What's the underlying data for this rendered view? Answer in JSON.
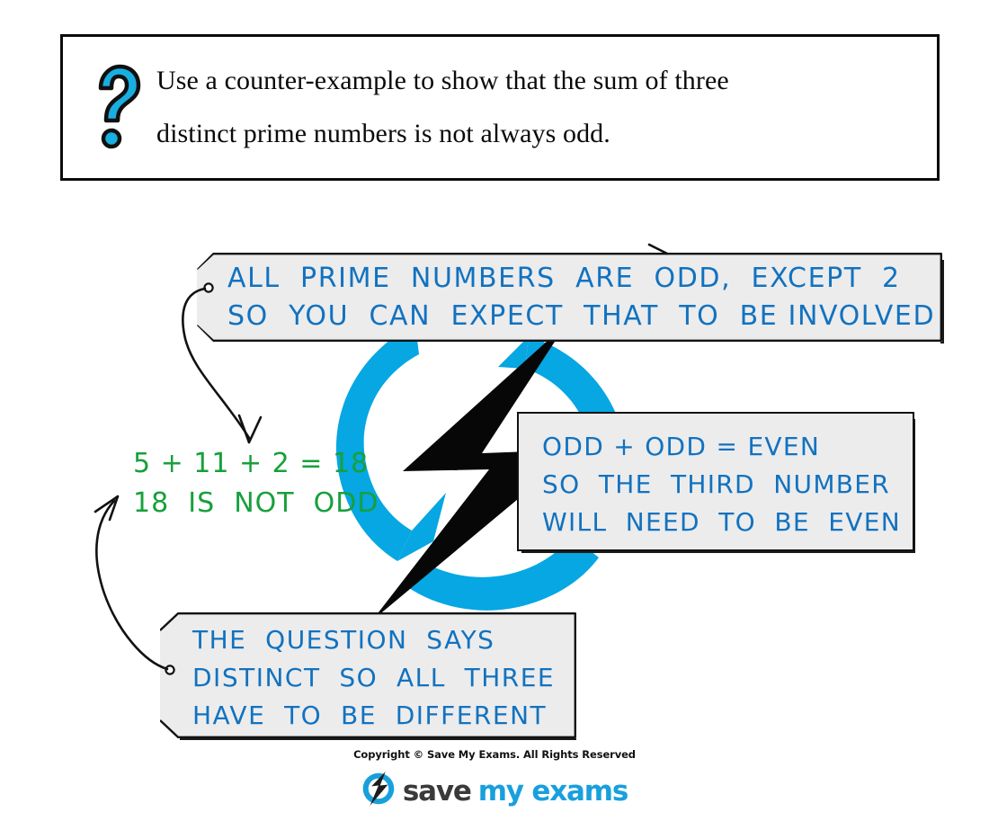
{
  "question": {
    "icon": "question-mark-icon",
    "line1": "Use a counter-example to show that the sum of three",
    "line2": "distinct prime numbers is not always odd."
  },
  "annotations": {
    "prime_note": {
      "line1": "ALL  PRIME  NUMBERS  ARE  ODD,  EXCEPT  2",
      "line2": "SO  YOU  CAN  EXPECT  THAT  TO  BE INVOLVED"
    },
    "odd_note": {
      "line1": "ODD + ODD = EVEN",
      "line2": "SO  THE  THIRD  NUMBER",
      "line3": "WILL  NEED  TO  BE  EVEN"
    },
    "distinct_note": {
      "line1": "THE  QUESTION  SAYS",
      "line2": "DISTINCT  SO  ALL  THREE",
      "line3": "HAVE  TO  BE  DIFFERENT"
    }
  },
  "working": {
    "line1": "5 + 11 + 2 = 18",
    "line2": "18  IS  NOT  ODD"
  },
  "footer": {
    "copyright": "Copyright © Save My Exams. All Rights Reserved",
    "logo_primary": "save",
    "logo_secondary": "my exams"
  },
  "colors": {
    "annotation_blue": "#1272bf",
    "working_green": "#17a03c",
    "icon_cyan": "#19aee0",
    "watermark_cyan": "#06a7e2",
    "box_fill": "#ececed",
    "outline_black": "#121212"
  }
}
